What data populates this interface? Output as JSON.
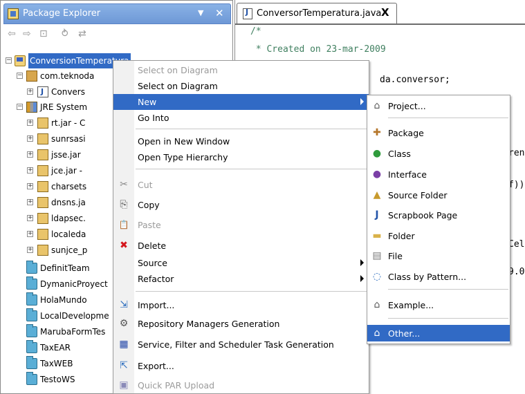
{
  "explorer": {
    "title": "Package Explorer",
    "menu_icon": "▼",
    "close_icon": "✕",
    "toolbar": [
      "⇦",
      "⇨",
      "⊡",
      "⥁",
      "⇄"
    ],
    "tree": [
      {
        "label": "ConversionTemperatura",
        "icon": "project-icon",
        "selected": true
      },
      {
        "label": "com.teknoda",
        "icon": "package-icon"
      },
      {
        "label": "Convers",
        "icon": "java-file-icon"
      },
      {
        "label": "JRE System",
        "icon": "library-icon"
      },
      {
        "label": "rt.jar - C",
        "icon": "jar-icon"
      },
      {
        "label": "sunrsasi",
        "icon": "jar-icon"
      },
      {
        "label": "jsse.jar",
        "icon": "jar-icon"
      },
      {
        "label": "jce.jar -",
        "icon": "jar-icon"
      },
      {
        "label": "charsets",
        "icon": "jar-icon"
      },
      {
        "label": "dnsns.ja",
        "icon": "jar-icon"
      },
      {
        "label": "ldapsec.",
        "icon": "jar-icon"
      },
      {
        "label": "localeda",
        "icon": "jar-icon"
      },
      {
        "label": "sunjce_p",
        "icon": "jar-icon"
      },
      {
        "label": "DefinitTeam",
        "icon": "folder-icon"
      },
      {
        "label": "DymanicProyect",
        "icon": "folder-icon"
      },
      {
        "label": "HolaMundo",
        "icon": "folder-icon"
      },
      {
        "label": "LocalDevelopme",
        "icon": "folder-icon"
      },
      {
        "label": "MarubaFormTes",
        "icon": "folder-icon"
      },
      {
        "label": "TaxEAR",
        "icon": "folder-icon"
      },
      {
        "label": "TaxWEB",
        "icon": "folder-icon"
      },
      {
        "label": "TestoWS",
        "icon": "folder-icon"
      }
    ]
  },
  "editor": {
    "tab_label": "ConversorTemperatura.java",
    "tab_close": "X",
    "code_lines": [
      "/*",
      " * Created on 23-mar-2009",
      "da.conversor;",
      "ren",
      "f))",
      "Cel",
      "9.0"
    ]
  },
  "context_menu": {
    "items": [
      {
        "label": "Select on Diagram",
        "icon": "",
        "disabled": true
      },
      {
        "label": "Select on Diagram",
        "icon": "",
        "disabled": false
      },
      {
        "label": "New",
        "icon": "",
        "selected": true,
        "submenu": true
      },
      {
        "label": "Go Into",
        "icon": ""
      },
      {
        "label": "Open in New Window",
        "icon": ""
      },
      {
        "label": "Open Type Hierarchy",
        "icon": ""
      },
      {
        "label": "Cut",
        "icon": "✂",
        "disabled": true
      },
      {
        "label": "Copy",
        "icon": "⎘"
      },
      {
        "label": "Paste",
        "icon": "📋",
        "disabled": true
      },
      {
        "label": "Delete",
        "icon": "✖"
      },
      {
        "label": "Source",
        "icon": "",
        "submenu": true
      },
      {
        "label": "Refactor",
        "icon": "",
        "submenu": true
      },
      {
        "label": "Import...",
        "icon": "⇲"
      },
      {
        "label": "Repository Managers Generation",
        "icon": "⚙"
      },
      {
        "label": "Service, Filter and Scheduler Task Generation",
        "icon": "▦"
      },
      {
        "label": "Export...",
        "icon": "⇱"
      },
      {
        "label": "Quick PAR Upload",
        "icon": "▣",
        "disabled": true
      }
    ]
  },
  "submenu": {
    "items": [
      {
        "label": "Project...",
        "icon": "⌂"
      },
      {
        "label": "Package",
        "icon": "✚"
      },
      {
        "label": "Class",
        "icon": "●"
      },
      {
        "label": "Interface",
        "icon": "●"
      },
      {
        "label": "Source Folder",
        "icon": "▲"
      },
      {
        "label": "Scrapbook Page",
        "icon": "J"
      },
      {
        "label": "Folder",
        "icon": "▬"
      },
      {
        "label": "File",
        "icon": "▤"
      },
      {
        "label": "Class by Pattern...",
        "icon": "◌"
      },
      {
        "label": "Example...",
        "icon": "⌂"
      },
      {
        "label": "Other...",
        "icon": "⌂",
        "selected": true
      }
    ]
  },
  "colors": {
    "selection": "#316ac5",
    "title_bar": "#7aa4de",
    "comment": "#3f7f5f"
  }
}
